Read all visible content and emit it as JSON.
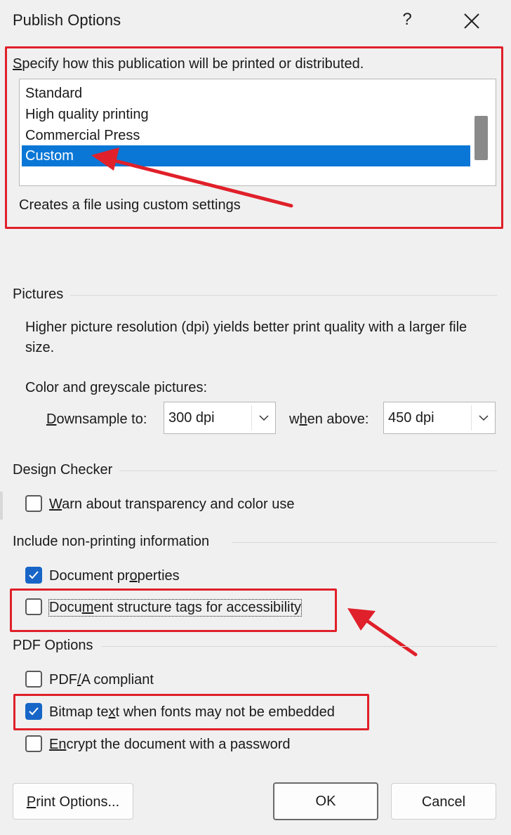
{
  "dialog": {
    "title": "Publish Options",
    "help_symbol": "?",
    "close_symbol": "✕"
  },
  "publish_type": {
    "prompt_rest": "pecify how this publication will be printed or distributed.",
    "prompt_mnemonic": "S",
    "items": [
      {
        "label": "Standard"
      },
      {
        "label": "High quality printing"
      },
      {
        "label": "Commercial Press"
      },
      {
        "label": "Custom"
      }
    ],
    "selected_index": 3,
    "description": "Creates a file using custom settings"
  },
  "pictures": {
    "title": "Pictures",
    "info": "Higher picture resolution (dpi) yields better print quality with a larger file size.",
    "info_line1": "Higher picture resolution (dpi) yields better print quality with a larger file",
    "info_line2": "size.",
    "color_label": "Color and greyscale pictures:",
    "downsample_label_mnemonic": "D",
    "downsample_label_rest": "ownsample to:",
    "downsample_value": "300 dpi",
    "when_above_pre": "w",
    "when_above_mnemonic": "h",
    "when_above_rest": "en above:",
    "when_above_value": "450 dpi"
  },
  "design_checker": {
    "title": "Design Checker",
    "warn_mnemonic": "W",
    "warn_rest": "arn about transparency and color use",
    "warn_checked": false
  },
  "non_printing": {
    "title": "Include non-printing information",
    "doc_props_pre": "Document pr",
    "doc_props_mnemonic": "o",
    "doc_props_rest": "perties",
    "doc_props_checked": true,
    "tags_pre": "Docu",
    "tags_mnemonic": "m",
    "tags_rest": "ent structure tags for accessibility",
    "tags_checked": false
  },
  "pdf_options": {
    "title": "PDF Options",
    "pdfa_pre": "PDF",
    "pdfa_mnemonic": "/",
    "pdfa_rest": "A compliant",
    "pdfa_checked": false,
    "bitmap_pre": "Bitmap te",
    "bitmap_mnemonic": "x",
    "bitmap_rest": "t when fonts may not be embedded",
    "bitmap_checked": true,
    "encrypt_mnemonic": "E",
    "encrypt_pre": "",
    "encrypt_mid": "n",
    "encrypt_rest": "crypt the document with a password",
    "encrypt_checked": false
  },
  "buttons": {
    "print_options_mnemonic": "P",
    "print_options_rest": "rint Options...",
    "ok": "OK",
    "cancel": "Cancel"
  },
  "colors": {
    "selection": "#0a77d6",
    "checkbox_on": "#1766c7",
    "annotation_red": "#e0202a",
    "dialog_bg": "#f0f0f0"
  }
}
